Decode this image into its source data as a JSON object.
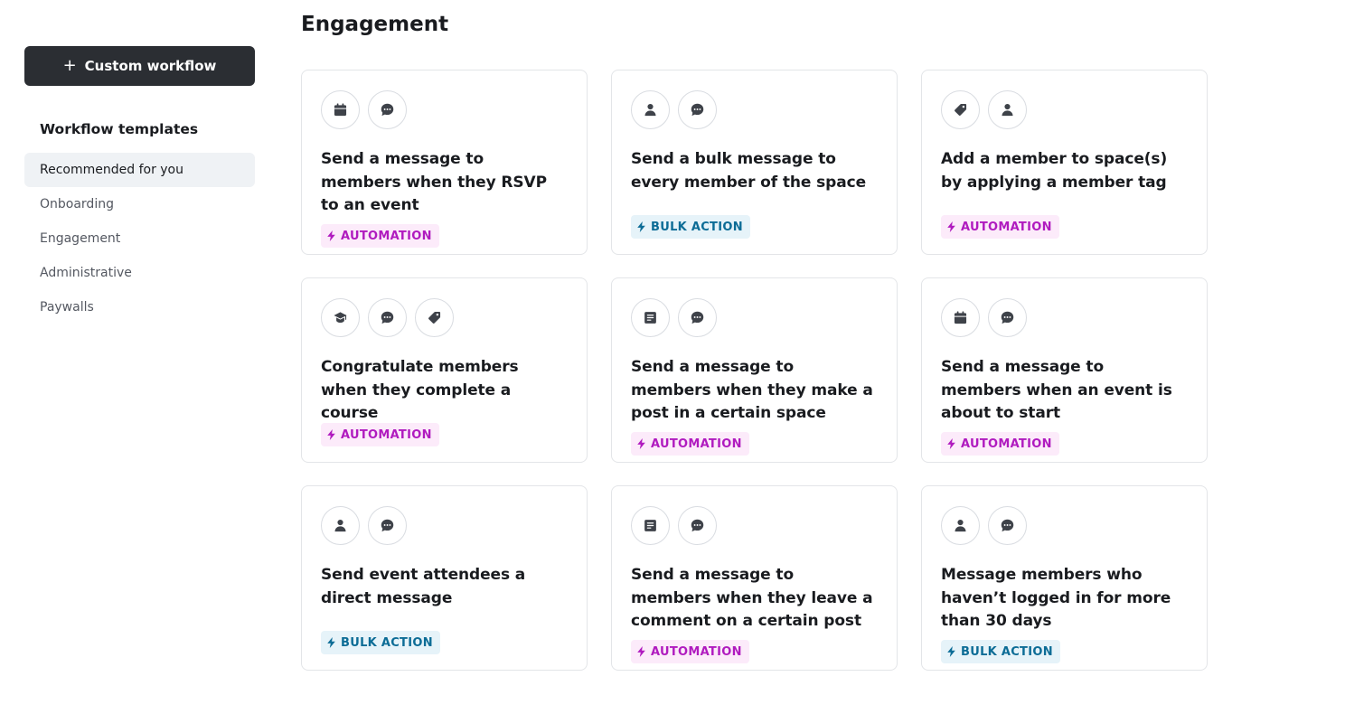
{
  "sidebar": {
    "custom_button_label": "Custom workflow",
    "templates_heading": "Workflow templates",
    "nav": [
      {
        "label": "Recommended for you",
        "active": true
      },
      {
        "label": "Onboarding"
      },
      {
        "label": "Engagement"
      },
      {
        "label": "Administrative"
      },
      {
        "label": "Paywalls"
      }
    ]
  },
  "main": {
    "title": "Engagement",
    "badge_labels": {
      "automation": "AUTOMATION",
      "bulk": "BULK ACTION"
    },
    "cards": [
      {
        "title": "Send a message to members when they RSVP to an event",
        "icons": [
          "calendar-icon",
          "chat-icon"
        ],
        "badge": "automation"
      },
      {
        "title": "Send a bulk message to every member of the space",
        "icons": [
          "user-icon",
          "chat-icon"
        ],
        "badge": "bulk"
      },
      {
        "title": "Add a member to space(s) by applying a member tag",
        "icons": [
          "tag-icon",
          "user-icon"
        ],
        "badge": "automation"
      },
      {
        "title": "Congratulate members when they complete a course",
        "icons": [
          "graduation-cap-icon",
          "chat-icon",
          "tag-icon"
        ],
        "badge": "automation"
      },
      {
        "title": "Send a message to members when they make a post in a certain space",
        "icons": [
          "post-icon",
          "chat-icon"
        ],
        "badge": "automation"
      },
      {
        "title": "Send a message to members when an event is about to start",
        "icons": [
          "calendar-icon",
          "chat-icon"
        ],
        "badge": "automation"
      },
      {
        "title": "Send event attendees a direct message",
        "icons": [
          "user-icon",
          "chat-icon"
        ],
        "badge": "bulk"
      },
      {
        "title": "Send a message to members when they leave a comment on a certain post",
        "icons": [
          "post-icon",
          "chat-icon"
        ],
        "badge": "automation"
      },
      {
        "title": "Message members who haven’t logged in for more than 30 days",
        "icons": [
          "user-icon",
          "chat-icon"
        ],
        "badge": "bulk"
      }
    ]
  }
}
